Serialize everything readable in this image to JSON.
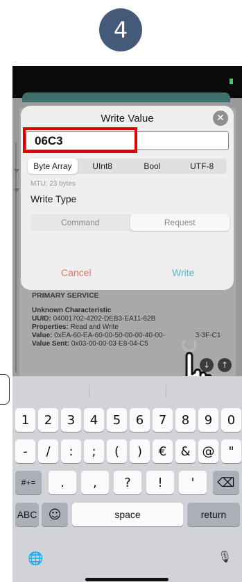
{
  "step_number": "4",
  "dialog": {
    "title": "Write Value",
    "close_symbol": "✕",
    "input_value": "06C3",
    "formats": [
      "Byte Array",
      "UInt8",
      "Bool",
      "UTF-8"
    ],
    "selected_format": "Byte Array",
    "mtu": "MTU: 23 bytes",
    "write_type_label": "Write Type",
    "write_types": [
      "Command",
      "Request"
    ],
    "selected_write_type": "Request",
    "cancel_label": "Cancel",
    "write_label": "Write"
  },
  "service": {
    "title": "PRIMARY SERVICE",
    "characteristic": "Unknown Characteristic",
    "uuid_label": "UUID:",
    "uuid_value": "04001702-4202-DEB3-EA11-62B",
    "properties_label": "Properties:",
    "properties_value": "Read and Write",
    "value_label": "Value:",
    "value_value": "0xEA-60-EA-60-00-50-00-00-40-00-",
    "value_tail": "3-3F-C1",
    "sent_label": "Value Sent:",
    "sent_value": "0x03-00-00-03-E8-04-C5"
  },
  "keyboard": {
    "row1": [
      "1",
      "2",
      "3",
      "4",
      "5",
      "6",
      "7",
      "8",
      "9",
      "0"
    ],
    "row2": [
      "-",
      "/",
      ":",
      ";",
      "(",
      ")",
      "€",
      "&",
      "@",
      "\""
    ],
    "row3_left": "#+=",
    "row3": [
      ".",
      ",",
      "?",
      "!",
      "'"
    ],
    "row3_right": "⌫",
    "abc": "ABC",
    "emoji": "☺",
    "space": "space",
    "return": "return",
    "globe": "🌐",
    "mic": "🎙"
  },
  "colors": {
    "badge": "#455a78",
    "highlight": "#e00000",
    "input_border": "#3f9aa0",
    "cancel": "#e0736a",
    "write": "#5fb3bd"
  }
}
